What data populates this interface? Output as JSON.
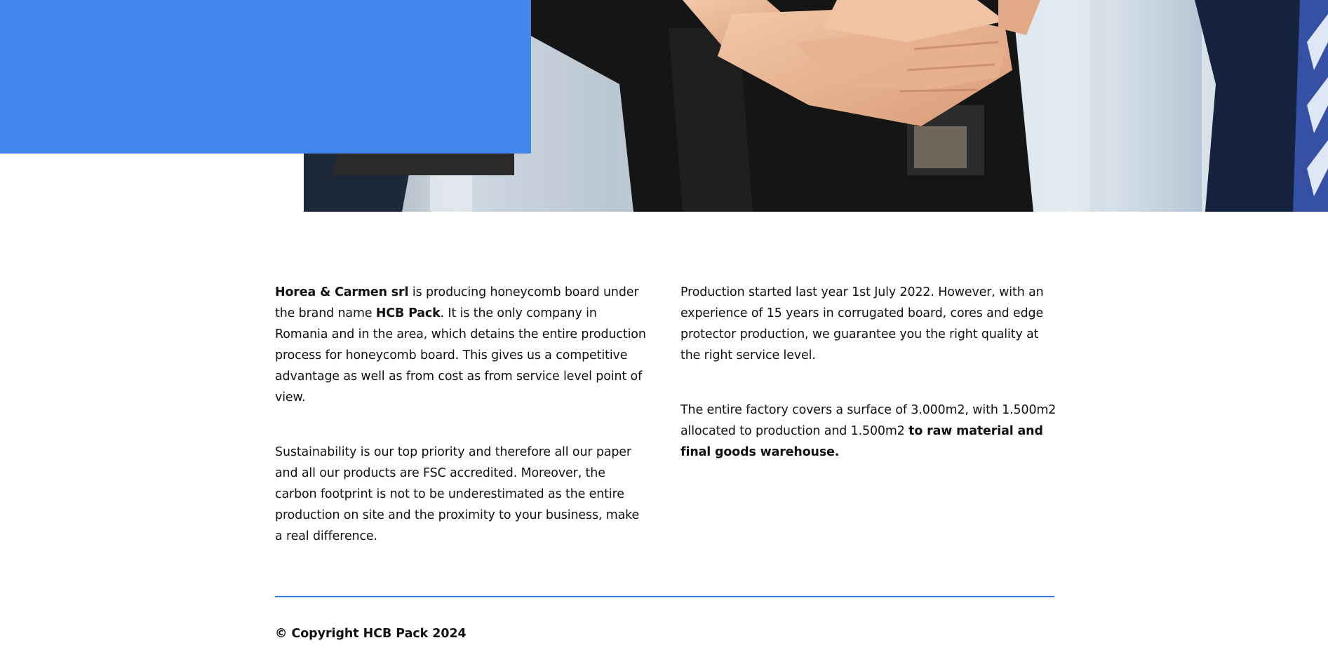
{
  "hero": {
    "image_alt": "team-stacked-hands-photo",
    "accent_color": "#4285eb"
  },
  "content": {
    "left": {
      "p1": {
        "company_bold": "Horea & Carmen srl",
        "text_a": " is producing honeycomb board under the brand name ",
        "brand_bold": "HCB Pack",
        "text_b": ". It is the only company in Romania and in the area, which detains the entire production process for honeycomb board. This gives us a competitive advantage as well as from cost as from service level point of view."
      },
      "p2": "Sustainability is our top priority and therefore all our paper and all our products are FSC accredited. Moreover, the carbon footprint is not to be underestimated as the entire production on site and the proximity to your business, make a real difference."
    },
    "right": {
      "p1": "Production started last year 1st July 2022. However, with an experience of 15 years in corrugated board, cores and edge protector production, we guarantee you the right quality at the right service level.",
      "p2": {
        "text_a": "The entire factory covers a surface of 3.000m2, with 1.500m2 allocated to production and 1.500m2 ",
        "bold": "to raw material and final goods warehouse."
      }
    }
  },
  "footer": {
    "divider_color": "#3b7be6",
    "copyright": "© Copyright HCB Pack 2024"
  }
}
